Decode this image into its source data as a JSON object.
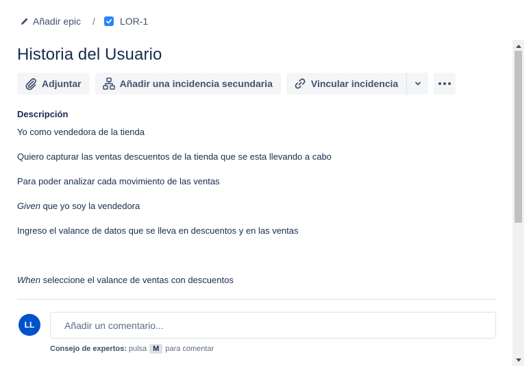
{
  "breadcrumb": {
    "add_epic": "Añadir epic",
    "separator": "/",
    "issue_key": "LOR-1"
  },
  "issue": {
    "title": "Historia del Usuario"
  },
  "toolbar": {
    "attach_label": "Adjuntar",
    "add_child_label": "Añadir una incidencia secundaria",
    "link_label": "Vincular incidencia"
  },
  "description": {
    "heading": "Descripción",
    "line1": "Yo como vendedora de la tienda",
    "line2": "Quiero capturar las ventas  descuentos de la tienda que se esta llevando a cabo",
    "line3": "Para poder analizar cada movimiento de las ventas",
    "line4_em": "Given",
    "line4_rest": " que yo soy la vendedora",
    "line5": "Ingreso el valance de datos que se lleva en descuentos y en las ventas",
    "line6_em": "When",
    "line6_rest": " seleccione el valance de ventas con descuentos"
  },
  "comment": {
    "avatar_initials": "LL",
    "placeholder": "Añadir un comentario...",
    "tip_label": "Consejo de expertos:",
    "tip_pre": "pulsa",
    "tip_key": "M",
    "tip_post": "para comentar"
  },
  "colors": {
    "accent": "#0052cc",
    "checkbox": "#2684ff",
    "button_bg": "#f4f5f7",
    "text": "#172b4d"
  },
  "icons": [
    "pencil-icon",
    "checkbox-icon",
    "paperclip-icon",
    "hierarchy-icon",
    "link-icon",
    "chevron-down-icon",
    "more-icon"
  ]
}
